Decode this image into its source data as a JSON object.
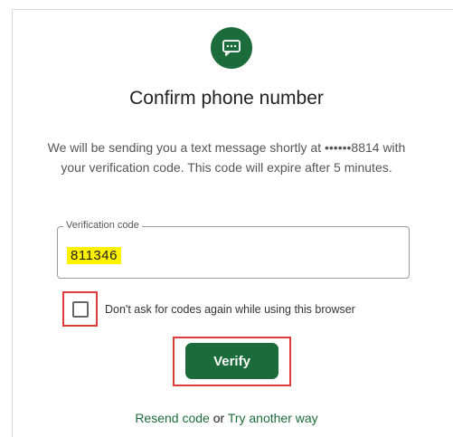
{
  "header": {
    "icon": "chat-message-icon",
    "title": "Confirm phone number"
  },
  "description": {
    "line1": "We will be sending you a text message shortly at ••••••8814 with",
    "line2": "your verification code. This code will expire after 5 minutes."
  },
  "verification": {
    "label": "Verification code",
    "value": "811346"
  },
  "remember": {
    "checked": false,
    "label": "Don't ask for codes again while using this browser"
  },
  "verify_button": {
    "label": "Verify"
  },
  "footer": {
    "resend_label": "Resend code",
    "or_label": "or",
    "try_another_label": "Try another way"
  },
  "colors": {
    "brand_green": "#1c6b3a",
    "highlight_red": "#e03c3c",
    "highlight_yellow": "#fff200"
  }
}
